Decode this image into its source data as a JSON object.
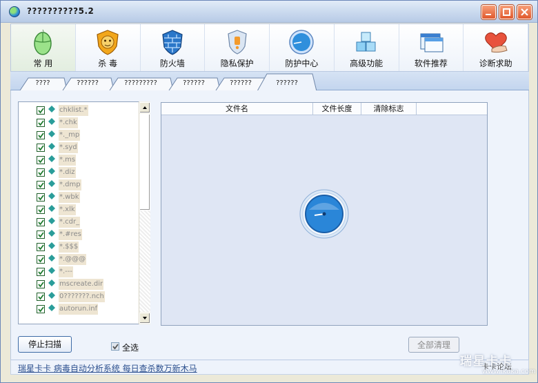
{
  "window": {
    "title": "??????????5.2"
  },
  "nav": [
    {
      "label": "常 用",
      "icon": "mouse-icon"
    },
    {
      "label": "杀 毒",
      "icon": "lion-shield-icon"
    },
    {
      "label": "防火墙",
      "icon": "firewall-icon"
    },
    {
      "label": "隐私保护",
      "icon": "privacy-shield-icon"
    },
    {
      "label": "防护中心",
      "icon": "protection-center-icon"
    },
    {
      "label": "高级功能",
      "icon": "cubes-icon"
    },
    {
      "label": "软件推荐",
      "icon": "software-windows-icon"
    },
    {
      "label": "诊断求助",
      "icon": "heart-hand-icon"
    }
  ],
  "tabs": [
    {
      "label": "????"
    },
    {
      "label": "??????"
    },
    {
      "label": "?????????"
    },
    {
      "label": "??????"
    },
    {
      "label": "??????"
    },
    {
      "label": "??????",
      "active": true
    }
  ],
  "extensions": [
    "chklist.*",
    "*.chk",
    "*._mp",
    "*.syd",
    "*.ms",
    "*.diz",
    "*.dmp",
    "*.wbk",
    "*.xlk",
    "*.cdr_",
    "*.#res",
    "*.$$$",
    "*.@@@",
    "*.---",
    "mscreate.dir",
    "0???????.nch",
    "autorun.inf"
  ],
  "file_table": {
    "col_name": "文件名",
    "col_size": "文件长度",
    "col_flag": "清除标志"
  },
  "controls": {
    "stop_scan": "停止扫描",
    "select_all": "全选",
    "clear_all": "全部清理"
  },
  "status": {
    "link_text": "瑞星卡卡  病毒自动分析系统  每日查杀数万新木马"
  },
  "watermark": {
    "brand": "瑞星卡卡",
    "url": "www.ikaka.com",
    "corner_text": "卡卡论坛"
  },
  "colors": {
    "accent": "#2e6fb6",
    "check": "#1f7a2e",
    "title_bar": "#c9d9ee"
  }
}
